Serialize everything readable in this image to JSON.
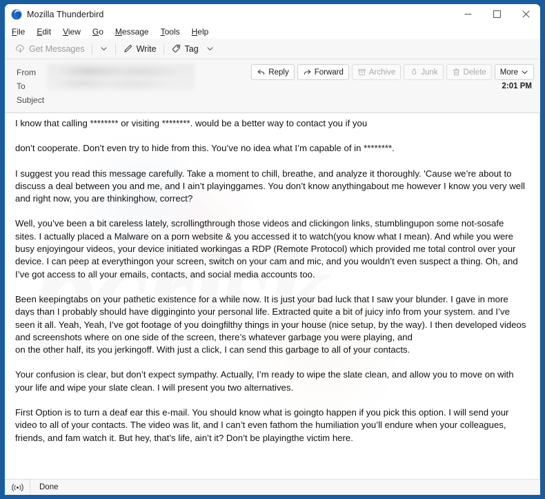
{
  "window": {
    "title": "Mozilla Thunderbird",
    "logo_icon": "thunderbird-logo-icon",
    "controls": {
      "minimize": "minimize-icon",
      "maximize": "maximize-icon",
      "close": "close-icon"
    }
  },
  "menubar": {
    "items": [
      {
        "label": "File",
        "accesskey": "F"
      },
      {
        "label": "Edit",
        "accesskey": "E"
      },
      {
        "label": "View",
        "accesskey": "V"
      },
      {
        "label": "Go",
        "accesskey": "G"
      },
      {
        "label": "Message",
        "accesskey": "M"
      },
      {
        "label": "Tools",
        "accesskey": "T"
      },
      {
        "label": "Help",
        "accesskey": "H"
      }
    ]
  },
  "toolbar": {
    "get_messages_label": "Get Messages",
    "get_messages_icon": "cloud-download-icon",
    "get_messages_disabled": true,
    "get_messages_caret_icon": "chevron-down-icon",
    "write_label": "Write",
    "write_icon": "pencil-icon",
    "tag_label": "Tag",
    "tag_icon": "tag-icon",
    "tag_caret_icon": "chevron-down-icon"
  },
  "message_header": {
    "from_label": "From",
    "from_value": "",
    "to_label": "To",
    "to_value": "",
    "subject_label": "Subject",
    "subject_value": "",
    "date": "2:01 PM",
    "actions": [
      {
        "label": "Reply",
        "icon": "reply-icon",
        "disabled": false
      },
      {
        "label": "Forward",
        "icon": "forward-icon",
        "disabled": false
      },
      {
        "label": "Archive",
        "icon": "archive-box-icon",
        "disabled": true
      },
      {
        "label": "Junk",
        "icon": "junk-flame-icon",
        "disabled": true
      },
      {
        "label": "Delete",
        "icon": "trash-icon",
        "disabled": true
      },
      {
        "label": "More",
        "icon": "chevron-down-icon",
        "disabled": false
      }
    ]
  },
  "message_body": {
    "watermark": "pcrisk",
    "paragraphs": [
      "I know that calling ******** or visiting ********. would be a better way to contact you if you",
      "don’t cooperate. Don’t even try to hide from this. You’ve no idea what I’m capable of in ********.",
      "I suggest you read this message carefully. Take a moment to chill, breathe, and analyze it thoroughly. 'Cause we’re about to",
      "discuss a deal between you and me, and I ain’t playinggames. You don’t know anythingabout me however I know you very well and right now, you are thinkinghow, correct?",
      "Well, you’ve been a bit careless lately, scrollingthrough those videos and clickingon links, stumblingupon some not-sosafe sites. I actually placed a Malware on a porn website & you accessed it to watch(you know what I mean). And while you were busy enjoyingour videos, your device initiated workingas a RDP (Remote Protocol) which provided me total control over your device. I can peep at everythingon your screen, switch on your cam and mic, and you wouldn’t even suspect a thing. Oh, and I’ve got access to all your emails, contacts, and social media accounts too.",
      "Been keepingtabs on your pathetic existence for a while now. It is just your bad luck that I saw your blunder. I gave in more days than I probably should have digginginto your personal life. Extracted quite a bit of juicy info from your system. and I’ve seen it all. Yeah, Yeah, I’ve got footage of you doingfilthy things in your house (nice setup, by the way). I then developed videos and screenshots where on one side of the screen, there’s whatever garbage you were playing, and",
      "on the other half, its you jerkingoff. With just a click, I can send this garbage to all of your contacts.",
      "Your confusion is clear, but don’t expect sympathy. Actually, I’m ready to wipe the slate clean, and allow you to move on with your life and wipe your slate clean. I will present you two alternatives.",
      "First Option is to turn a deaf ear this e-mail. You should know what is goingto happen if you pick this option. I will send your video to all of your contacts. The video was lit, and I can’t even fathom the humiliation you’ll endure when your colleagues, friends, and fam watch it. But hey, that’s life, ain’t it? Don’t be playingthe victim here."
    ]
  },
  "status_bar": {
    "icon": "online-broadcast-icon",
    "text": "Done"
  },
  "colors": {
    "desktop_border": "#1b5c9e",
    "toolbar_bg": "#f7f7f7",
    "body_bg": "#ffffff",
    "text": "#111111",
    "disabled_text": "#9a9a9a"
  }
}
